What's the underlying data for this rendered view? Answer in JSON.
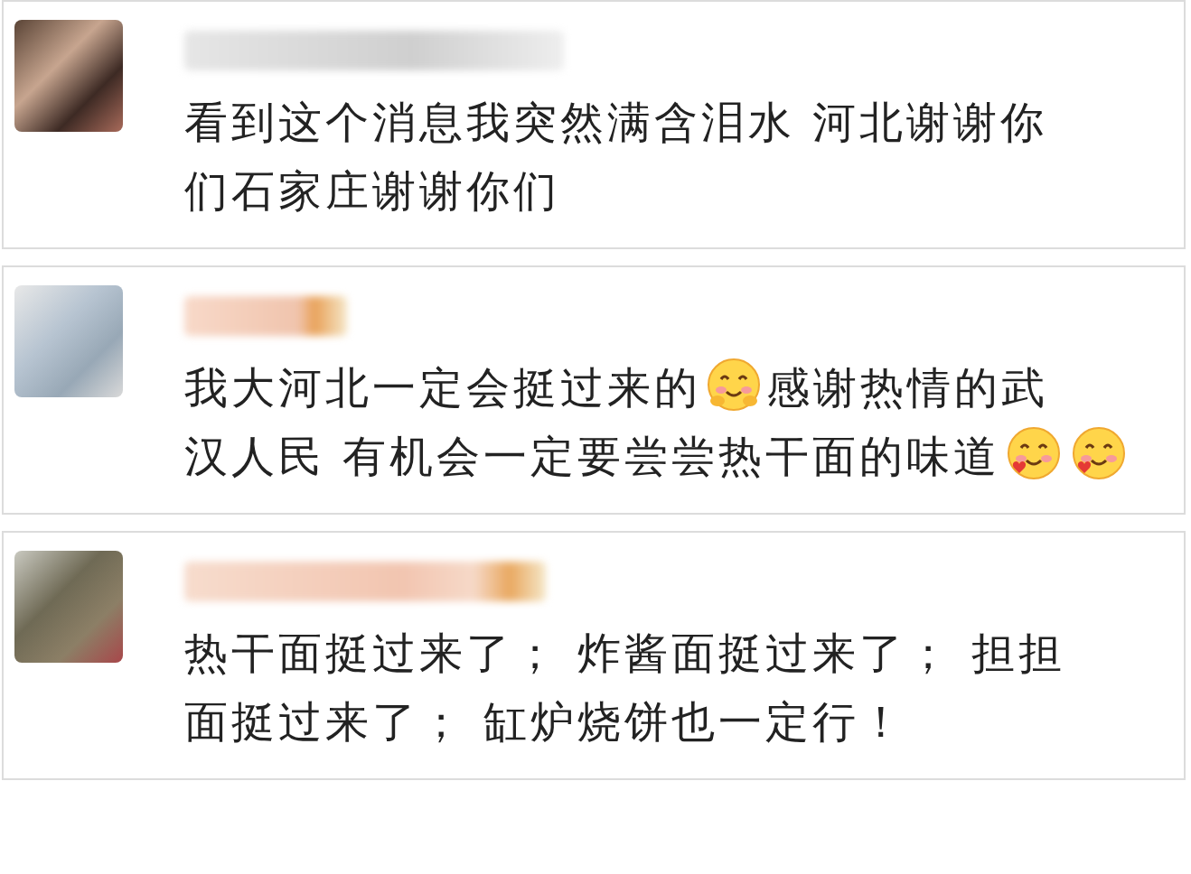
{
  "comments": [
    {
      "parts": [
        {
          "kind": "text",
          "text": "看到这个消息我突然满含泪水 河北谢谢你"
        },
        {
          "kind": "text",
          "text": "们石家庄谢谢你们"
        }
      ]
    },
    {
      "parts": [
        {
          "kind": "text",
          "text": "我大河北一定会挺过来的"
        },
        {
          "kind": "hug"
        },
        {
          "kind": "text",
          "text": "感谢热情的武"
        },
        {
          "kind": "text",
          "text": "汉人民 有机会一定要尝尝热干面的味道"
        },
        {
          "kind": "love"
        },
        {
          "kind": "love"
        }
      ]
    },
    {
      "parts": [
        {
          "kind": "text",
          "text": "热干面挺过来了； 炸酱面挺过来了； 担担"
        },
        {
          "kind": "text",
          "text": "面挺过来了； 缸炉烧饼也一定行！"
        }
      ]
    }
  ]
}
